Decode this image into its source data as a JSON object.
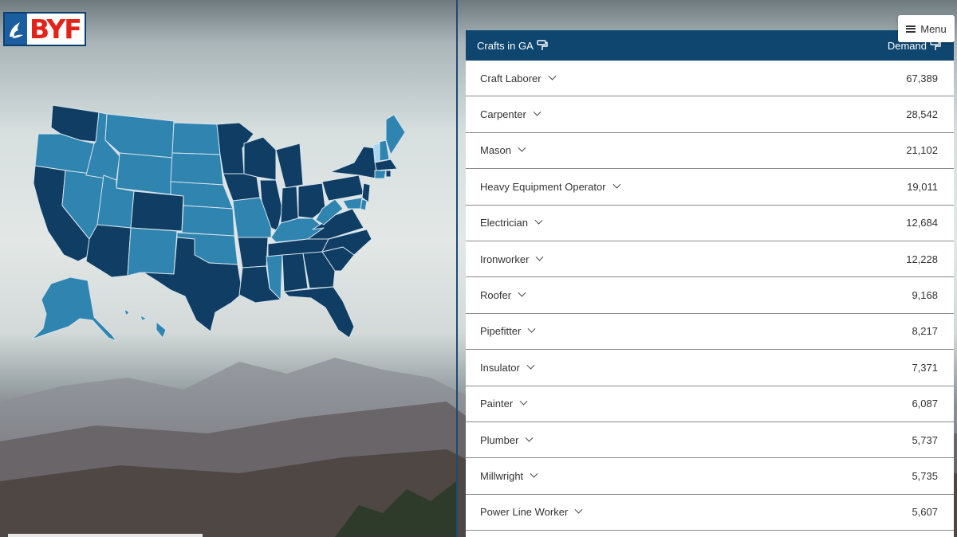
{
  "brand": {
    "logo_text": "BYF"
  },
  "menu": {
    "label": "Menu"
  },
  "table": {
    "header_left": "Crafts in GA",
    "header_right": "Demand",
    "rows": [
      {
        "craft": "Craft Laborer",
        "demand": "67,389"
      },
      {
        "craft": "Carpenter",
        "demand": "28,542"
      },
      {
        "craft": "Mason",
        "demand": "21,102"
      },
      {
        "craft": "Heavy Equipment Operator",
        "demand": "19,011"
      },
      {
        "craft": "Electrician",
        "demand": "12,684"
      },
      {
        "craft": "Ironworker",
        "demand": "12,228"
      },
      {
        "craft": "Roofer",
        "demand": "9,168"
      },
      {
        "craft": "Pipefitter",
        "demand": "8,217"
      },
      {
        "craft": "Insulator",
        "demand": "7,371"
      },
      {
        "craft": "Painter",
        "demand": "6,087"
      },
      {
        "craft": "Plumber",
        "demand": "5,737"
      },
      {
        "craft": "Millwright",
        "demand": "5,735"
      },
      {
        "craft": "Power Line Worker",
        "demand": "5,607"
      }
    ]
  },
  "colors": {
    "dark": "#0f3d63",
    "medium": "#2f84b0",
    "light": "#a8d8f0",
    "header": "#0e4670"
  }
}
